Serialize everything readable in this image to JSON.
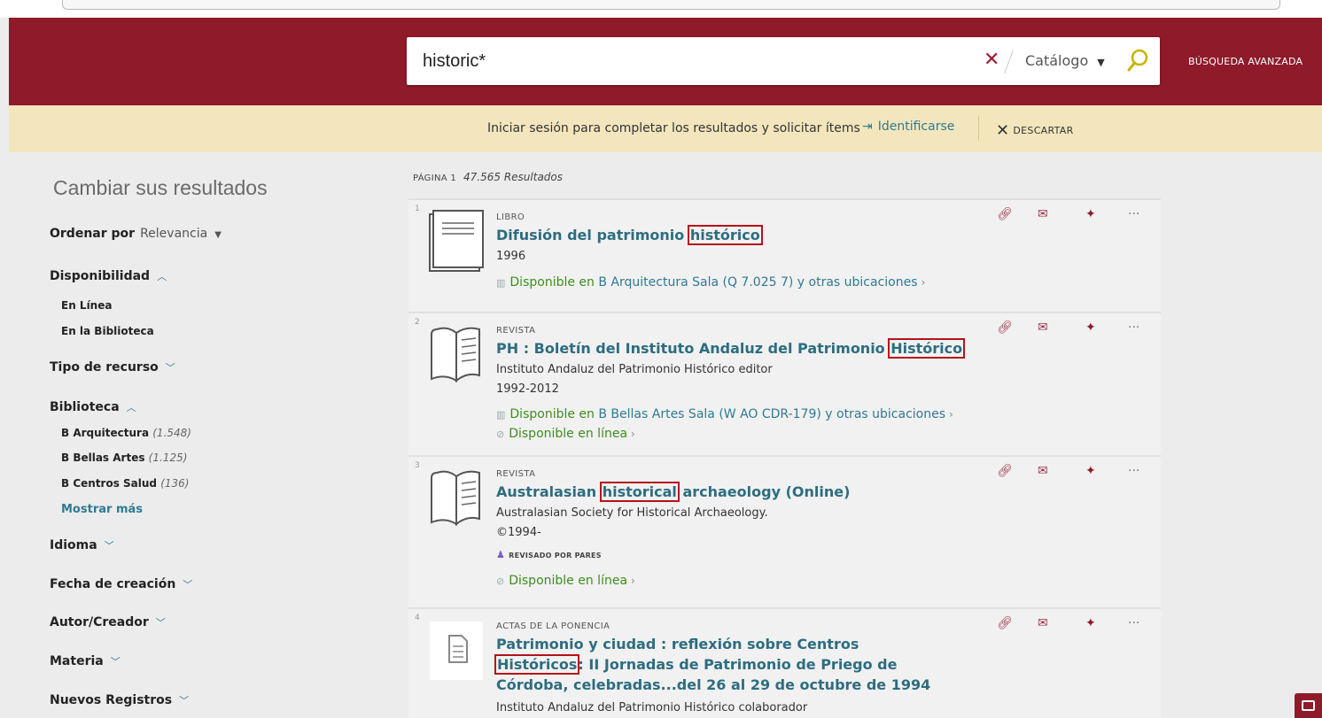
{
  "header": {
    "search_value": "historic*",
    "clear_label": "✕",
    "scope_label": "Catálogo",
    "advanced_search": "BÚSQUEDA AVANZADA"
  },
  "banner": {
    "text": "Iniciar sesión para completar los resultados y solicitar ítems",
    "identify": "Identificarse",
    "dismiss": "DESCARTAR"
  },
  "sidebar": {
    "title": "Cambiar sus resultados",
    "sort_label": "Ordenar por",
    "sort_value": "Relevancia",
    "facets": [
      {
        "label": "Disponibilidad",
        "expanded": true
      },
      {
        "label": "Tipo de recurso",
        "expanded": false
      },
      {
        "label": "Biblioteca",
        "expanded": true
      },
      {
        "label": "Idioma",
        "expanded": false
      },
      {
        "label": "Fecha de creación",
        "expanded": false
      },
      {
        "label": "Autor/Creador",
        "expanded": false
      },
      {
        "label": "Materia",
        "expanded": false
      },
      {
        "label": "Nuevos Registros",
        "expanded": false
      }
    ],
    "availability_items": [
      "En Línea",
      "En la Biblioteca"
    ],
    "library_items": [
      {
        "name": "B Arquitectura",
        "count": "(1.548)"
      },
      {
        "name": "B Bellas Artes",
        "count": "(1.125)"
      },
      {
        "name": "B Centros Salud",
        "count": "(136)"
      }
    ],
    "show_more": "Mostrar más"
  },
  "results_header": {
    "page": "PÁGINA 1",
    "count": "47.565 Resultados"
  },
  "results": [
    {
      "num": "1",
      "type": "LIBRO",
      "title_pre": "Difusión del patrimonio ",
      "title_hl": "histórico",
      "title_post": "",
      "meta1": "1996",
      "avail_pre": "Disponible en",
      "avail_loc": "B Arquitectura  Sala (Q 7.025 7) y otras ubicaciones"
    },
    {
      "num": "2",
      "type": "REVISTA",
      "title_pre": "PH : Boletín del Instituto Andaluz del Patrimonio ",
      "title_hl": "Histórico",
      "title_post": "",
      "meta1": "Instituto Andaluz del Patrimonio Histórico editor",
      "meta2": "1992-2012",
      "avail_pre": "Disponible en",
      "avail_loc": "B Bellas Artes  Sala (W AO CDR-179) y otras ubicaciones",
      "online": "Disponible en línea"
    },
    {
      "num": "3",
      "type": "REVISTA",
      "title_pre": "Australasian ",
      "title_hl": "historical",
      "title_post": " archaeology (Online)",
      "meta1": "Australasian Society for Historical Archaeology.",
      "meta2": "©1994-",
      "peer": "REVISADO POR PARES",
      "online": "Disponible en línea"
    },
    {
      "num": "4",
      "type": "ACTAS DE LA PONENCIA",
      "title_pre": "Patrimonio y ciudad : reflexión sobre Centros ",
      "title_hl": "Históricos",
      "title_post": ": II Jornadas de Patrimonio de Priego de Córdoba, celebradas...del 26 al 29 de octubre de 1994",
      "meta1": "Instituto Andaluz del Patrimonio Histórico colaborador"
    }
  ],
  "colors": {
    "header": "#8e1a2a",
    "banner": "#f3e6bd",
    "link": "#2d6d80",
    "available": "#3e8d1c",
    "highlight": "#b5121b"
  }
}
